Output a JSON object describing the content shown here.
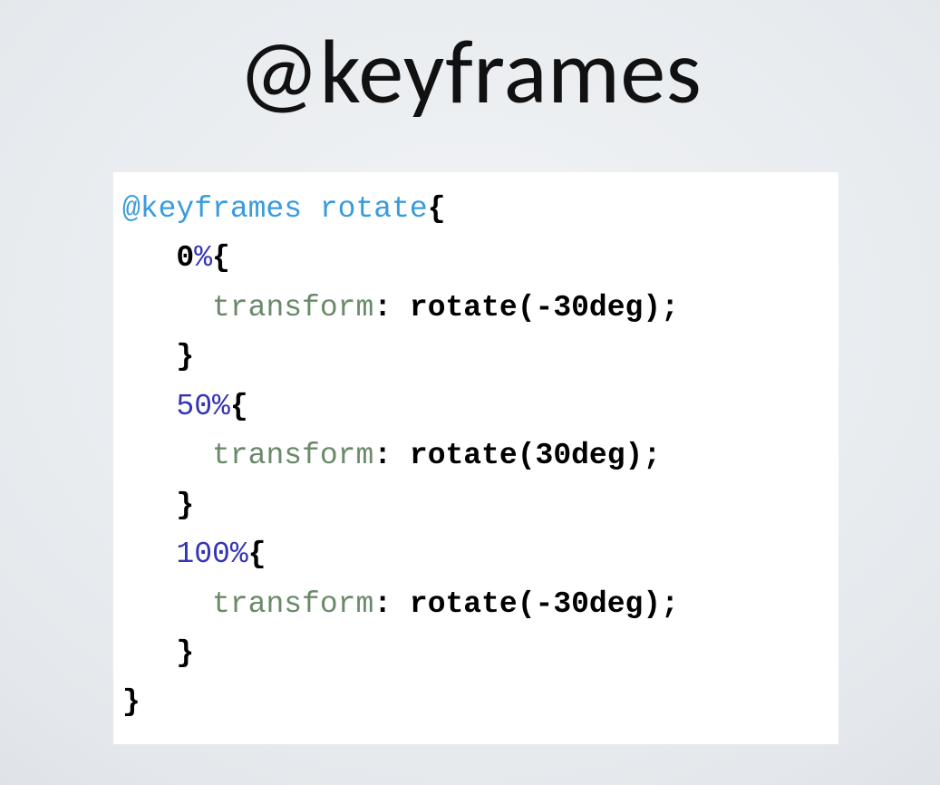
{
  "title": "@keyframes",
  "code": {
    "line1_keyword": "@keyframes",
    "line1_space": " ",
    "line1_name": "rotate",
    "line1_brace": "{",
    "line2_indent": "   ",
    "line2_zero": "0",
    "line2_pct": "%",
    "line2_brace": "{",
    "line3_indent": "     ",
    "line3_prop": "transform",
    "line3_colon": ":",
    "line3_space": " ",
    "line3_val": "rotate(-30deg)",
    "line3_semi": ";",
    "line4_indent": "   ",
    "line4_brace": "}",
    "line5_indent": "   ",
    "line5_pct": "50%",
    "line5_brace": "{",
    "line6_indent": "     ",
    "line6_prop": "transform",
    "line6_colon": ":",
    "line6_space": " ",
    "line6_val": "rotate(30deg)",
    "line6_semi": ";",
    "line7_indent": "   ",
    "line7_brace": "}",
    "line8_indent": "   ",
    "line8_pct": "100%",
    "line8_brace": "{",
    "line9_indent": "     ",
    "line9_prop": "transform",
    "line9_colon": ":",
    "line9_space": " ",
    "line9_val": "rotate(-30deg)",
    "line9_semi": ";",
    "line10_indent": "   ",
    "line10_brace": "}",
    "line11_brace": "}"
  }
}
